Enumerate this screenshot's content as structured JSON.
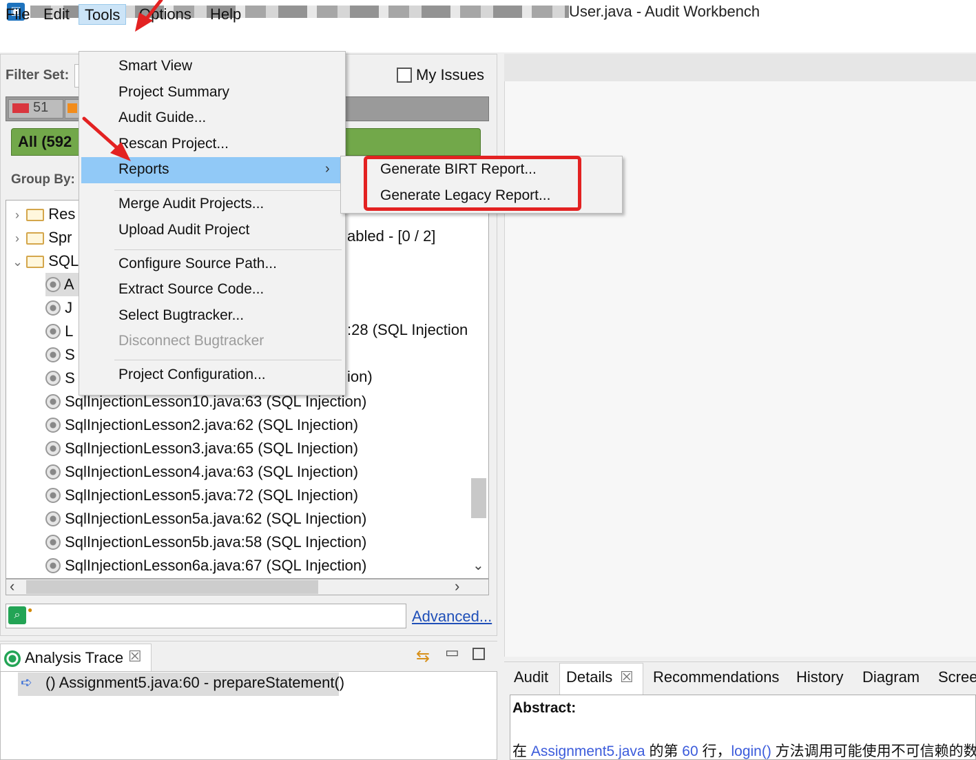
{
  "window": {
    "title": "User.java - Audit Workbench",
    "app_icon": "audit-workbench-icon"
  },
  "menubar": {
    "items": [
      "File",
      "Edit",
      "Tools",
      "Options",
      "Help"
    ],
    "active": "Tools"
  },
  "filter_panel": {
    "filter_set_label": "Filter Set:",
    "my_issues_label": "My Issues",
    "my_issues_checked": false,
    "severity": [
      {
        "label": "critical",
        "count": "51",
        "color": "#d9363e"
      },
      {
        "label": "high",
        "color": "#f28c1b"
      }
    ],
    "folder_tab": "All (592",
    "group_by_label": "Group By:"
  },
  "tree": {
    "folders": [
      {
        "label": "Res",
        "expanded": false
      },
      {
        "label": "Spr",
        "expanded": false
      },
      {
        "label": "SQL",
        "expanded": true
      }
    ],
    "partial_rows": [
      "A",
      "J",
      "L",
      "S",
      "S"
    ],
    "right_fragments": {
      "row1": "abled - [0 / 2]",
      "row2": ":28 (SQL Injection",
      "row3": "ion)"
    },
    "issues": [
      "SqlInjectionLesson10.java:63 (SQL Injection)",
      "SqlInjectionLesson2.java:62 (SQL Injection)",
      "SqlInjectionLesson3.java:65 (SQL Injection)",
      "SqlInjectionLesson4.java:63 (SQL Injection)",
      "SqlInjectionLesson5.java:72 (SQL Injection)",
      "SqlInjectionLesson5a.java:62 (SQL Injection)",
      "SqlInjectionLesson5b.java:58 (SQL Injection)",
      "SqlInjectionLesson6a.java:67 (SQL Injection)"
    ]
  },
  "search": {
    "value": "",
    "advanced_link": "Advanced..."
  },
  "analysis_trace": {
    "tab_title": "Analysis Trace",
    "close_glyph": "☒",
    "row": "Assignment5.java:60 - prepareStatement()"
  },
  "tools_menu": {
    "items": [
      {
        "label": "Smart View",
        "enabled": true
      },
      {
        "label": "Project Summary",
        "enabled": true
      },
      {
        "label": "Audit Guide...",
        "enabled": true
      },
      {
        "label": "Rescan Project...",
        "enabled": true
      },
      {
        "label": "Reports",
        "enabled": true,
        "submenu": true,
        "highlighted": true
      },
      {
        "label": "Merge Audit Projects...",
        "enabled": true
      },
      {
        "label": "Upload Audit Project",
        "enabled": true
      },
      {
        "label": "Configure Source Path...",
        "enabled": true
      },
      {
        "label": "Extract Source Code...",
        "enabled": true
      },
      {
        "label": "Select Bugtracker...",
        "enabled": true
      },
      {
        "label": "Disconnect Bugtracker",
        "enabled": false
      },
      {
        "label": "Project Configuration...",
        "enabled": true
      }
    ]
  },
  "reports_submenu": {
    "items": [
      "Generate BIRT Report...",
      "Generate Legacy Report..."
    ]
  },
  "details_panel": {
    "tabs": [
      "Audit",
      "Details",
      "Recommendations",
      "History",
      "Diagram",
      "Scree"
    ],
    "active_tab": "Details",
    "close_glyph": "☒",
    "abstract_label": "Abstract:",
    "abstract_parts": {
      "prefix": "在 ",
      "file": "Assignment5.java",
      "mid1": " 的第 ",
      "line": "60",
      "mid2": " 行，",
      "method": "login()",
      "suffix": " 方法调用可能使用不可信赖的数"
    }
  },
  "colors": {
    "accent_highlight": "#91c9f7",
    "annotation_red": "#e32222",
    "folder_tab_green": "#72a84a",
    "link_blue": "#1f4fb8"
  }
}
